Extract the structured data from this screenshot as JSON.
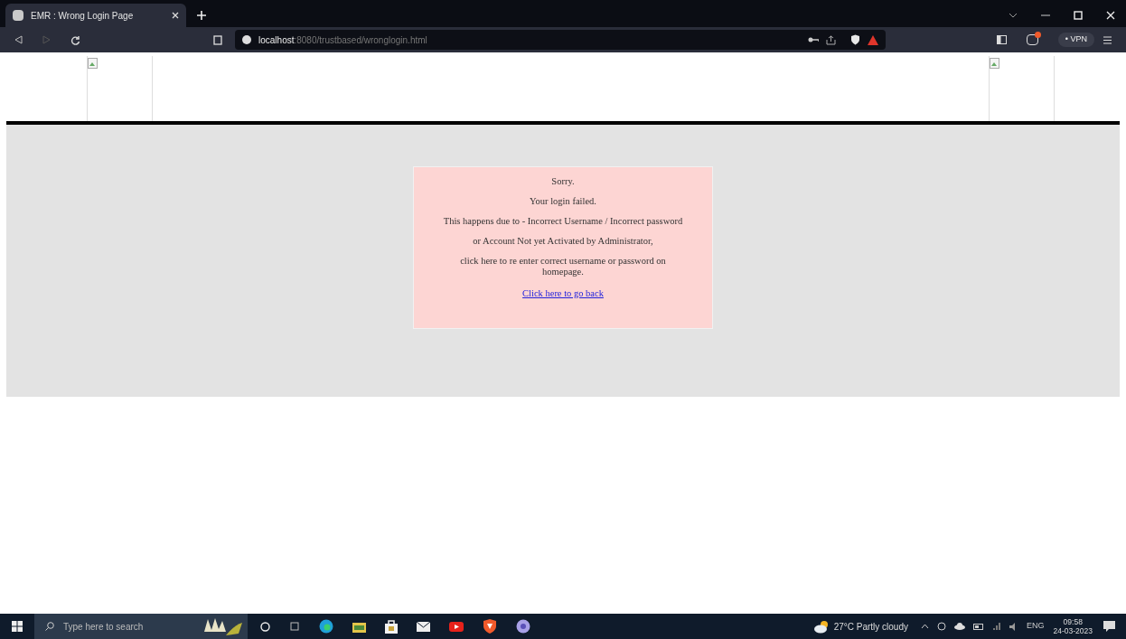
{
  "browser": {
    "tab_title": "EMR : Wrong Login Page",
    "url_host": "localhost",
    "url_path": ":8080/trustbased/wronglogin.html",
    "vpn_label": "• VPN"
  },
  "message": {
    "lines": [
      "Sorry.",
      "Your login failed.",
      "This happens due to - Incorrect Username / Incorrect password",
      "or Account Not yet Activated by Administrator,",
      "click  here to re enter correct  username or password on homepage."
    ],
    "link": "Click here to go back"
  },
  "taskbar": {
    "search_placeholder": "Type here to search",
    "weather": "27°C  Partly cloudy",
    "language": "ENG",
    "time": "09:58",
    "date": "24-03-2023"
  }
}
